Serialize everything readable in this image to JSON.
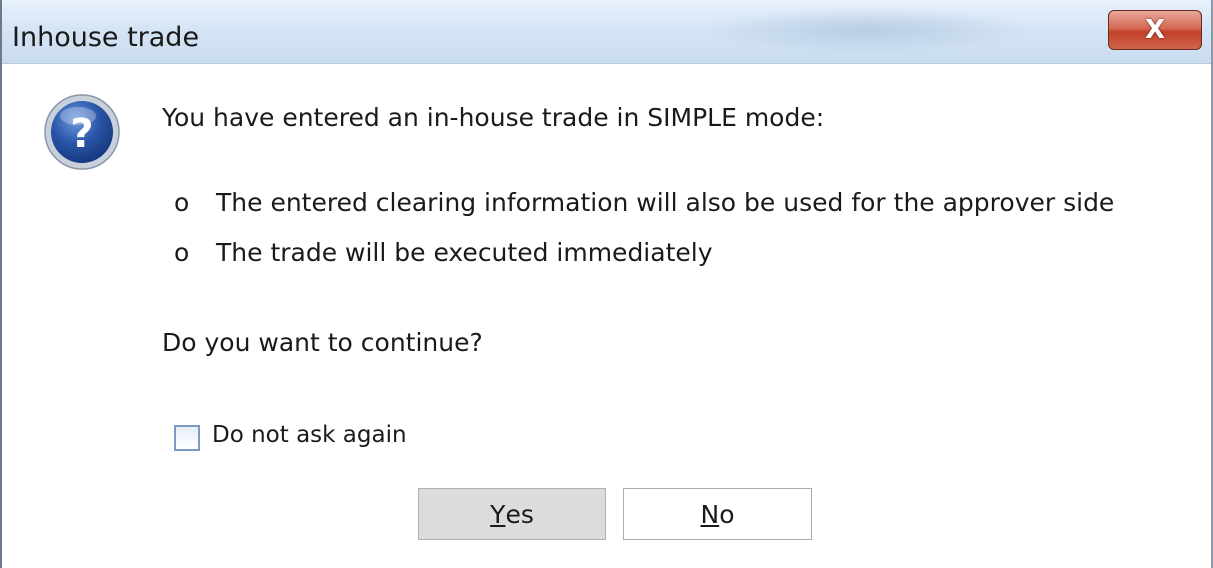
{
  "window": {
    "title": "Inhouse trade",
    "close_label": "X"
  },
  "dialog": {
    "icon": "question-icon",
    "intro": "You have entered an in-house trade in SIMPLE mode:",
    "bullets": [
      {
        "marker": "o",
        "text": "The entered clearing information will also be used for the approver side"
      },
      {
        "marker": "o",
        "text": "The trade will be executed immediately"
      }
    ],
    "question": "Do you want to continue?",
    "checkbox": {
      "label": "Do not ask again",
      "checked": false
    }
  },
  "buttons": {
    "yes": {
      "accel": "Y",
      "rest": "es"
    },
    "no": {
      "accel": "N",
      "rest": "o"
    }
  },
  "colors": {
    "close_button": "#c2412a",
    "titlebar": "#d6e5f5",
    "question_icon": "#2a55a8"
  }
}
